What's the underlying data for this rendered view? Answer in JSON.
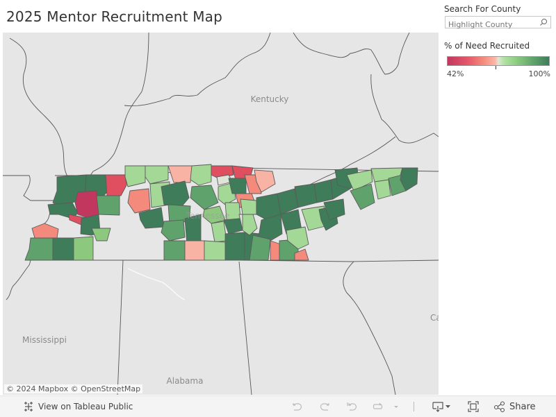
{
  "title": "2025 Mentor Recruitment Map",
  "search": {
    "label": "Search For County",
    "placeholder": "Highlight County",
    "icon": "search-icon"
  },
  "legend": {
    "title": "% of Need Recruited",
    "min_label": "42%",
    "max_label": "100%",
    "min": 42,
    "max": 100,
    "colors": [
      "#c2375e",
      "#f48a7c",
      "#e4e4d8",
      "#8ccc80",
      "#3f7c5a"
    ]
  },
  "map": {
    "place_labels": [
      "Kentucky",
      "Tennessee",
      "Mississippi",
      "Alabama",
      "Ca"
    ],
    "attribution": "© 2024 Mapbox  © OpenStreetMap",
    "county_colors": {
      "dark_red": "#c2375e",
      "red": "#e04f5f",
      "salmon": "#f48a7c",
      "light_salmon": "#f8b3a5",
      "neutral": "#dfe4d6",
      "light_green": "#a4d896",
      "green": "#8cc97f",
      "mid_green": "#5fa26c",
      "dark_green": "#3f7c5a",
      "none": "#e3e3e3"
    }
  },
  "toolbar": {
    "view_on_public": "View on Tableau Public",
    "share": "Share",
    "undo": "undo-icon",
    "redo": "redo-icon",
    "revert": "revert-icon",
    "refresh": "refresh-icon",
    "download": "download-icon",
    "fullscreen": "fullscreen-icon"
  }
}
